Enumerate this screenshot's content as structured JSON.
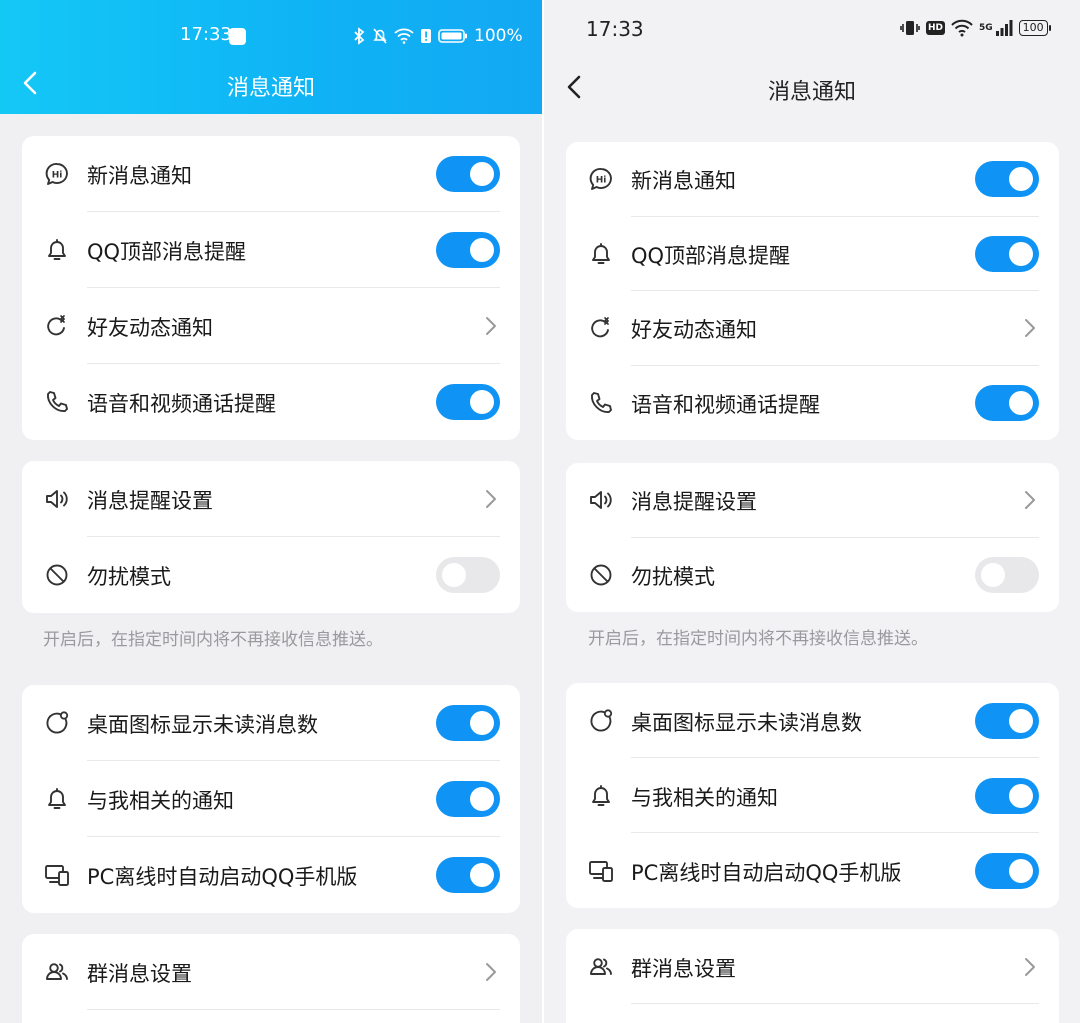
{
  "left": {
    "status": {
      "time": "17:33",
      "battery": "100%"
    },
    "title": "消息通知",
    "group1": [
      {
        "label": "新消息通知",
        "icon": "hi-chat-icon",
        "control": "toggle",
        "on": true
      },
      {
        "label": "QQ顶部消息提醒",
        "icon": "bell-icon",
        "control": "toggle",
        "on": true
      },
      {
        "label": "好友动态通知",
        "icon": "refresh-star-icon",
        "control": "chevron"
      },
      {
        "label": "语音和视频通话提醒",
        "icon": "phone-icon",
        "control": "toggle",
        "on": true
      }
    ],
    "group2": [
      {
        "label": "消息提醒设置",
        "icon": "speaker-icon",
        "control": "chevron"
      },
      {
        "label": "勿扰模式",
        "icon": "no-disturb-icon",
        "control": "toggle",
        "on": false
      }
    ],
    "hint": "开启后，在指定时间内将不再接收信息推送。",
    "group3": [
      {
        "label": "桌面图标显示未读消息数",
        "icon": "badge-icon",
        "control": "toggle",
        "on": true
      },
      {
        "label": "与我相关的通知",
        "icon": "bell-icon",
        "control": "toggle",
        "on": true
      },
      {
        "label": "PC离线时自动启动QQ手机版",
        "icon": "devices-icon",
        "control": "toggle",
        "on": true
      }
    ],
    "group4": [
      {
        "label": "群消息设置",
        "icon": "group-icon",
        "control": "chevron"
      }
    ]
  },
  "right": {
    "status": {
      "time": "17:33",
      "battery": "100",
      "network": "5G",
      "hd": "HD"
    },
    "title": "消息通知",
    "group1": [
      {
        "label": "新消息通知",
        "icon": "hi-chat-icon",
        "control": "toggle",
        "on": true
      },
      {
        "label": "QQ顶部消息提醒",
        "icon": "bell-icon",
        "control": "toggle",
        "on": true
      },
      {
        "label": "好友动态通知",
        "icon": "refresh-star-icon",
        "control": "chevron"
      },
      {
        "label": "语音和视频通话提醒",
        "icon": "phone-icon",
        "control": "toggle",
        "on": true
      }
    ],
    "group2": [
      {
        "label": "消息提醒设置",
        "icon": "speaker-icon",
        "control": "chevron"
      },
      {
        "label": "勿扰模式",
        "icon": "no-disturb-icon",
        "control": "toggle",
        "on": false
      }
    ],
    "hint": "开启后，在指定时间内将不再接收信息推送。",
    "group3": [
      {
        "label": "桌面图标显示未读消息数",
        "icon": "badge-icon",
        "control": "toggle",
        "on": true
      },
      {
        "label": "与我相关的通知",
        "icon": "bell-icon",
        "control": "toggle",
        "on": true
      },
      {
        "label": "PC离线时自动启动QQ手机版",
        "icon": "devices-icon",
        "control": "toggle",
        "on": true
      }
    ],
    "group4": [
      {
        "label": "群消息设置",
        "icon": "group-icon",
        "control": "chevron"
      }
    ]
  },
  "colors": {
    "accent": "#0f94f5",
    "header_left": "#14c8f6",
    "toggle_off": "#e8e8ea"
  }
}
